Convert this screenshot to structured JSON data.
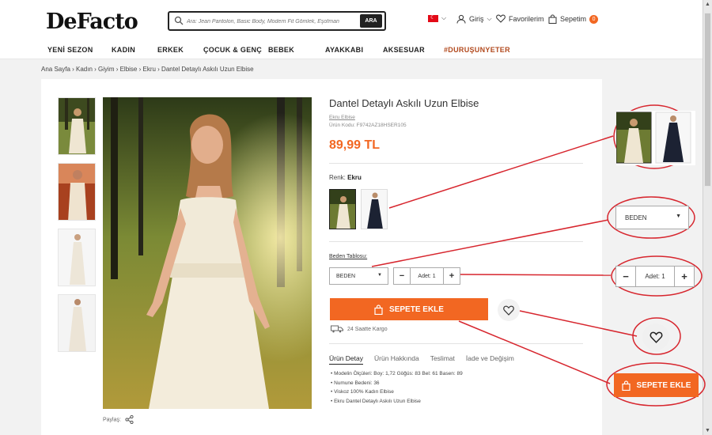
{
  "header": {
    "logo": "DeFacto",
    "search_placeholder": "Ara: Jean Pantolon, Basic Body, Modern Fit Gömlek, Eşofman",
    "search_button": "ARA",
    "login": "Giriş",
    "favorites": "Favorilerim",
    "cart": "Sepetim",
    "cart_count": "0"
  },
  "nav": [
    "YENİ SEZON",
    "KADIN",
    "ERKEK",
    "ÇOCUK & GENÇ",
    "BEBEK",
    "AYAKKABI",
    "AKSESUAR",
    "#DURUŞUNYETER"
  ],
  "breadcrumb": "Ana Sayfa › Kadın › Giyim › Elbise › Ekru › Dantel Detaylı Askılı Uzun Elbise",
  "product": {
    "title": "Dantel Detaylı Askılı Uzun Elbise",
    "color_link": "Ekru Elbise",
    "code": "Ürün Kodu: F9742AZ18HSER105",
    "price": "89,99 TL",
    "color_label": "Renk:",
    "color_value": "Ekru",
    "size_table": "Beden Tablosu:",
    "size_placeholder": "BEDEN",
    "qty_minus": "−",
    "qty_value": "Adet: 1",
    "qty_plus": "+",
    "add_to_cart": "SEPETE EKLE",
    "shipping": "24 Saatte Kargo",
    "share": "Paylaş:"
  },
  "tabs": [
    "Ürün Detay",
    "Ürün Hakkında",
    "Teslimat",
    "İade ve Değişim"
  ],
  "details": [
    "Modelin Ölçüleri: Boy: 1,72 Göğüs: 83 Bel: 61 Basen: 89",
    "Numune Bedeni: 36",
    "Viskoz 100% Kadın Elbise",
    "Ekru Dantel Detaylı Askılı Uzun Elbise"
  ],
  "zoom": {
    "size_placeholder": "BEDEN",
    "qty_minus": "−",
    "qty_value": "Adet: 1",
    "qty_plus": "+",
    "add_to_cart": "SEPETE EKLE"
  },
  "colors": {
    "accent": "#f26722",
    "annotation": "#d7262e",
    "dark_swatch": "#1c2233"
  }
}
